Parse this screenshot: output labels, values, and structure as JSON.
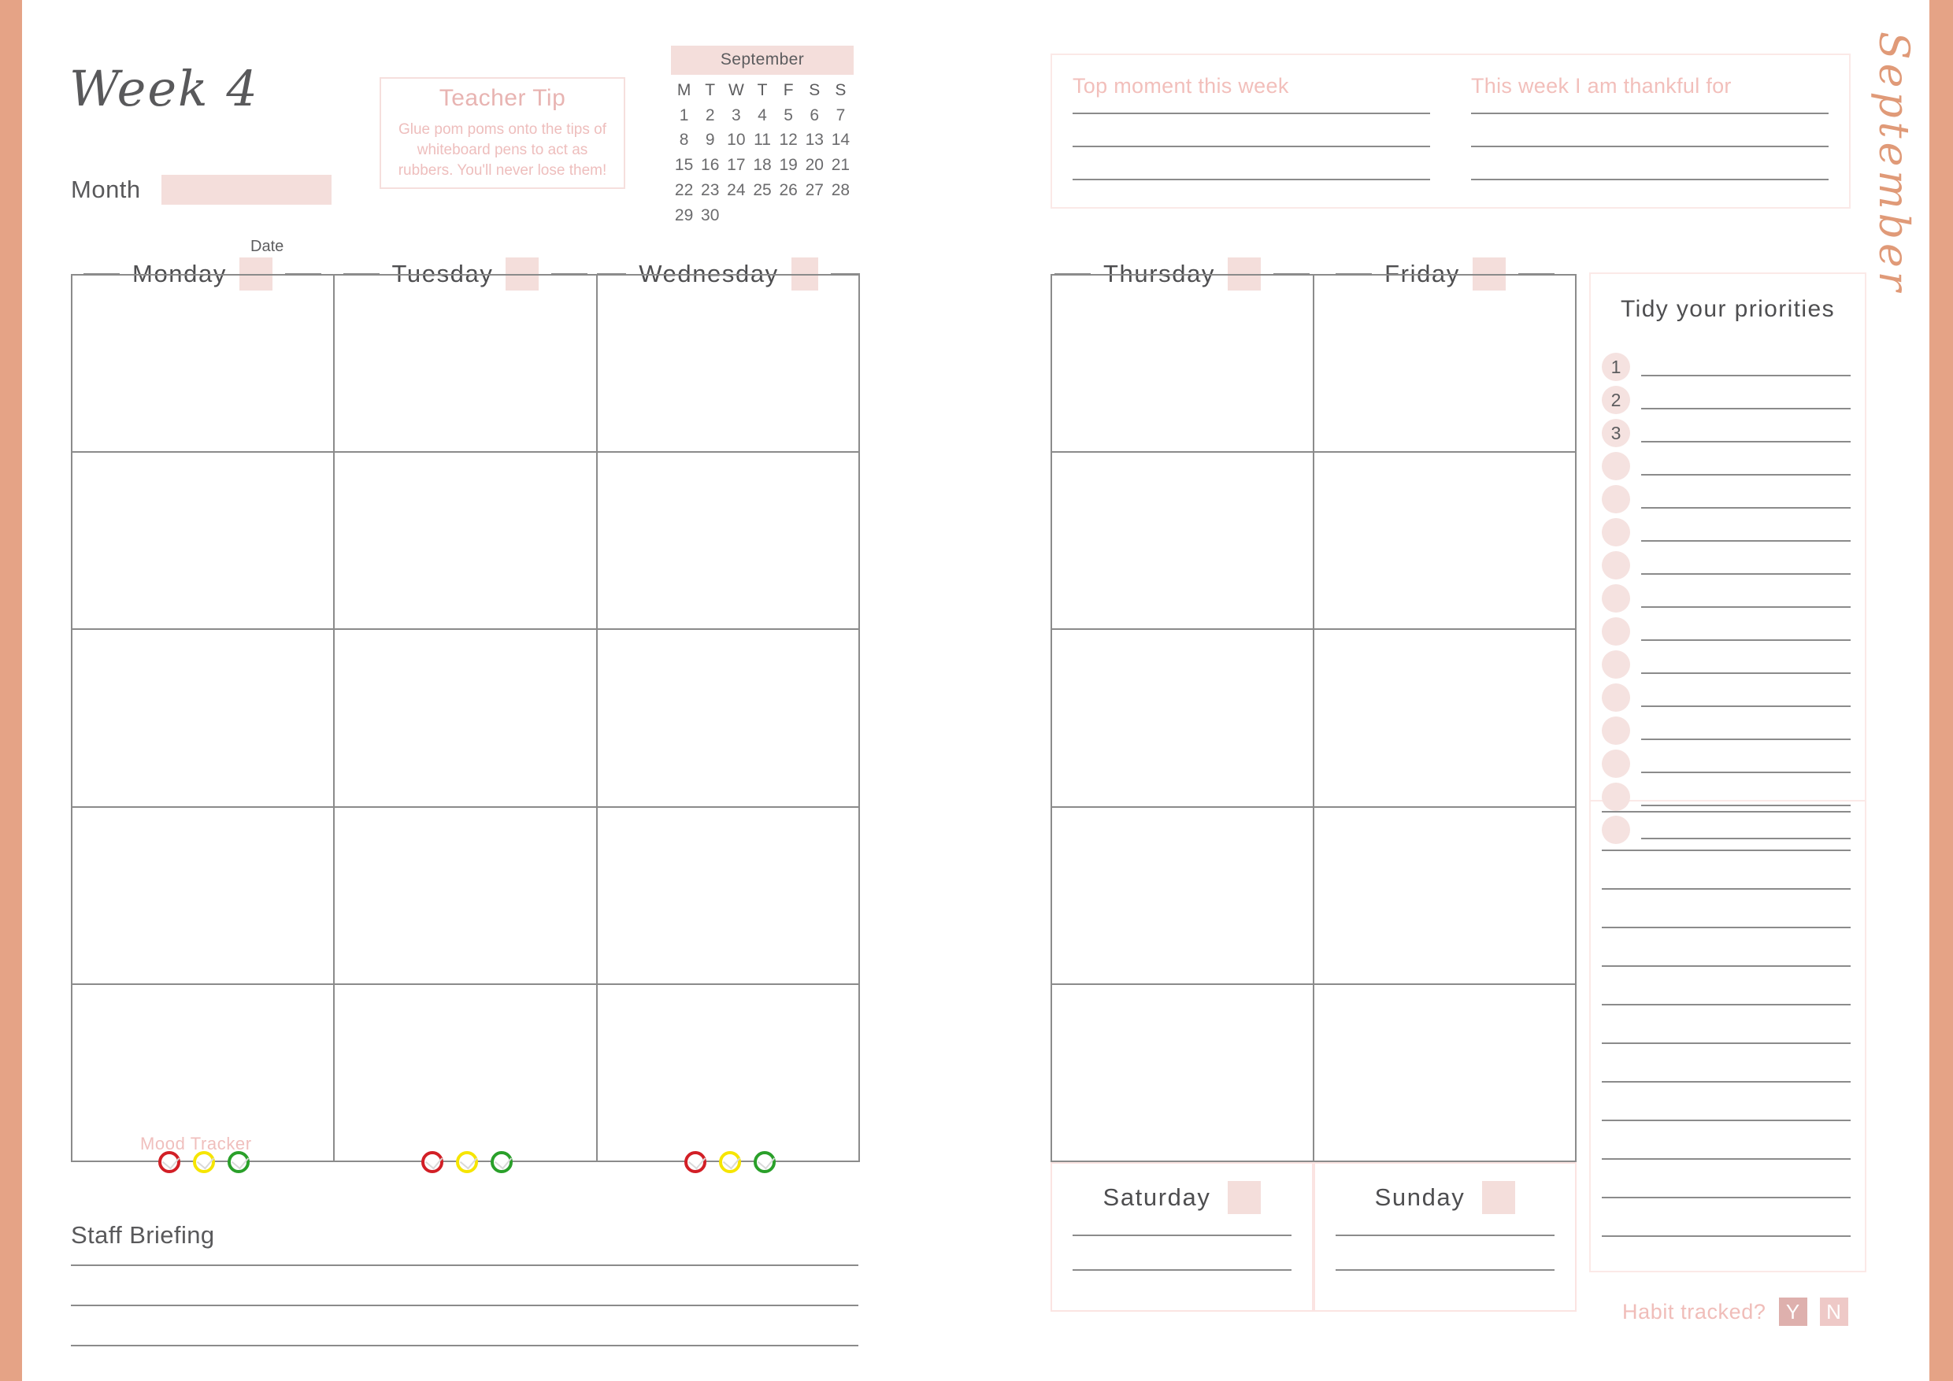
{
  "theme": {
    "edge_band": "#e5a386",
    "pink_fill": "#f4dedb",
    "pink_text": "#eebebd",
    "rule": "#8b8b8b",
    "ink": "#59595b"
  },
  "left_page": {
    "week_title": "Week 4",
    "month_label": "Month",
    "month_value": "",
    "teacher_tip": {
      "title": "Teacher Tip",
      "body": "Glue pom poms onto the tips of whiteboard pens to act as rubbers. You'll never lose them!"
    },
    "mini_calendar": {
      "month": "September",
      "day_initials": [
        "M",
        "T",
        "W",
        "T",
        "F",
        "S",
        "S"
      ],
      "leading_blanks": 0,
      "days": [
        1,
        2,
        3,
        4,
        5,
        6,
        7,
        8,
        9,
        10,
        11,
        12,
        13,
        14,
        15,
        16,
        17,
        18,
        19,
        20,
        21,
        22,
        23,
        24,
        25,
        26,
        27,
        28,
        29,
        30
      ]
    },
    "date_caption": "Date",
    "days": [
      {
        "name": "Monday",
        "date_value": ""
      },
      {
        "name": "Tuesday",
        "date_value": ""
      },
      {
        "name": "Wednesday",
        "date_value": ""
      }
    ],
    "mood_tracker": {
      "label": "Mood Tracker",
      "colors": [
        "red",
        "yellow",
        "green"
      ]
    },
    "staff_briefing": {
      "title": "Staff Briefing",
      "line_count": 3
    },
    "grid_rows": 5
  },
  "right_page": {
    "reflections": [
      {
        "title": "Top moment this week",
        "line_count": 3
      },
      {
        "title": "This week I am thankful for",
        "line_count": 3
      }
    ],
    "vertical_month": "September",
    "days": [
      {
        "name": "Thursday",
        "date_value": ""
      },
      {
        "name": "Friday",
        "date_value": ""
      }
    ],
    "weekend_days": [
      {
        "name": "Saturday",
        "date_value": "",
        "line_count": 2
      },
      {
        "name": "Sunday",
        "date_value": "",
        "line_count": 2
      }
    ],
    "grid_rows": 5,
    "priorities": {
      "title": "Tidy your priorities",
      "numbered": [
        "1",
        "2",
        "3"
      ],
      "blank_bullets": 12,
      "extra_lines": 12
    },
    "habit": {
      "label": "Habit tracked?",
      "yes": "Y",
      "no": "N"
    }
  }
}
